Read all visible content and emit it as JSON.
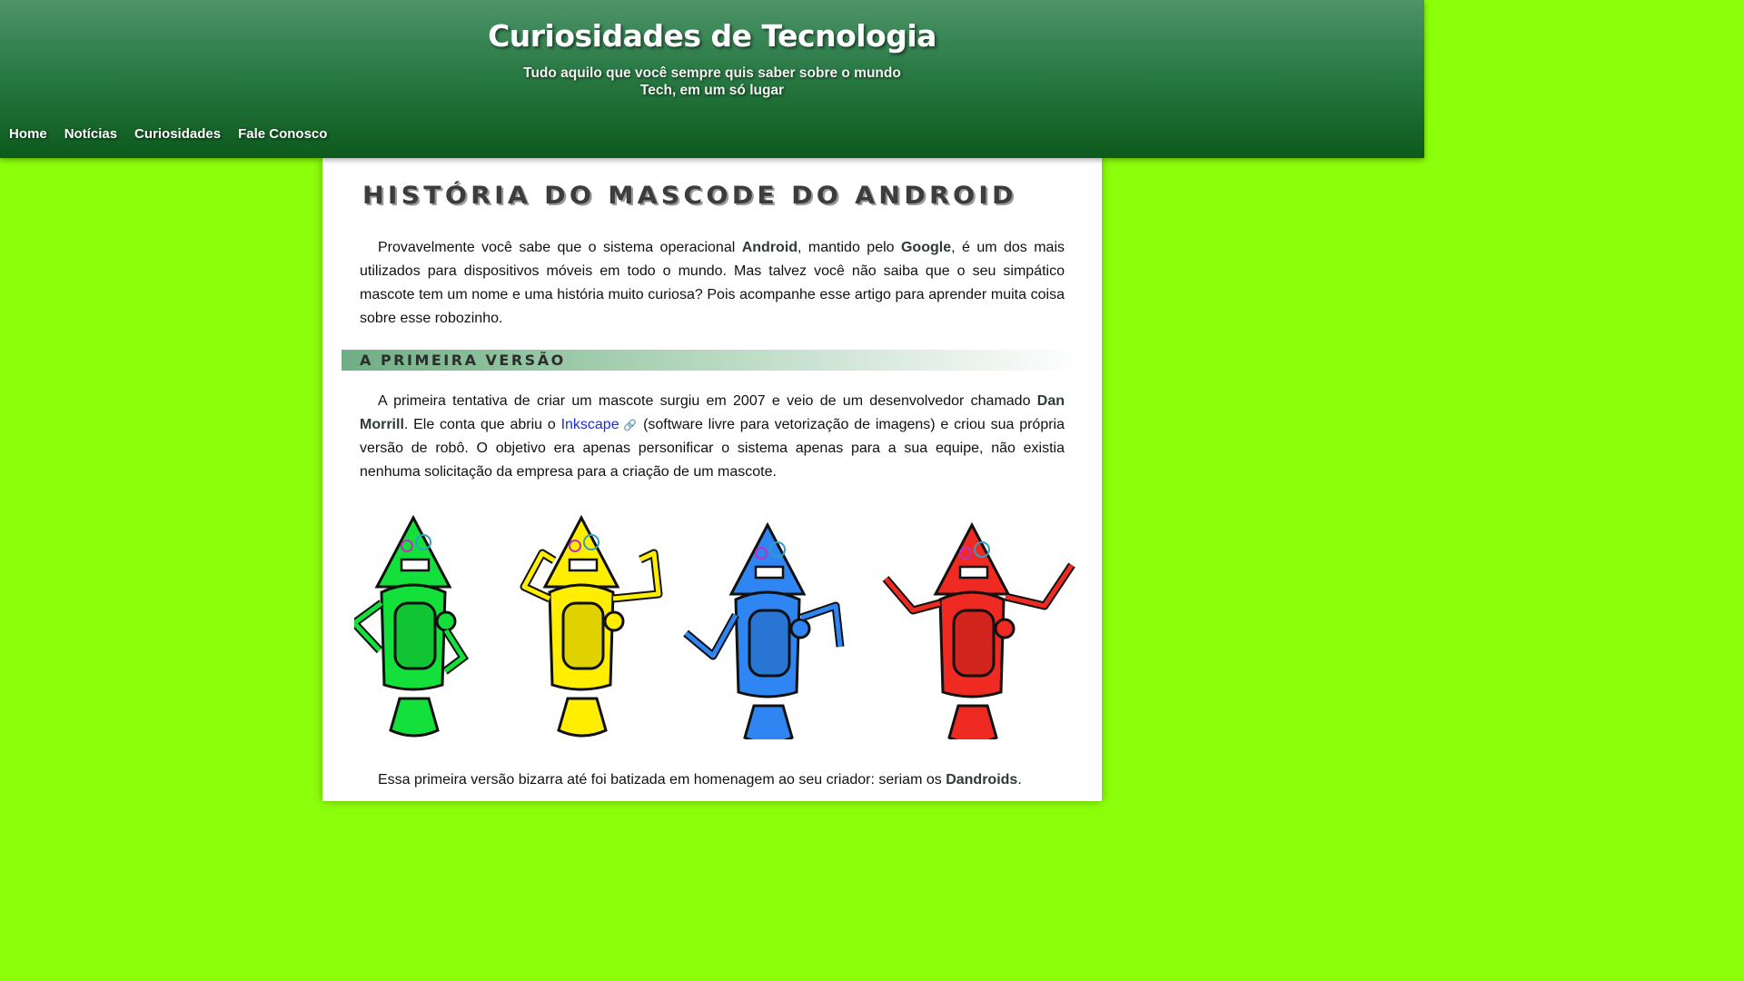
{
  "site": {
    "title": "Curiosidades de Tecnologia",
    "subtitle": "Tudo aquilo que você sempre quis saber sobre o mundo Tech, em um só lugar"
  },
  "nav": {
    "items": [
      "Home",
      "Notícias",
      "Curiosidades",
      "Fale Conosco"
    ]
  },
  "article": {
    "title": "HISTÓRIA DO MASCODE DO ANDROID",
    "intro": {
      "t1": "Provavelmente você sabe que o sistema operacional ",
      "b1": "Android",
      "t2": ", mantido pelo ",
      "b2": "Google",
      "t3": ", é um dos mais utilizados para dispositivos móveis em todo o mundo. Mas talvez você não saiba que o seu simpático mascote tem um nome e uma história muito curiosa? Pois acompanhe esse artigo para aprender muita coisa sobre esse robozinho."
    },
    "section1": {
      "heading": "A PRIMEIRA VERSÃO",
      "p1": {
        "t1": "A primeira tentativa de criar um mascote surgiu em 2007 e veio de um desenvolvedor chamado ",
        "b1": "Dan Morrill",
        "t2": ". Ele conta que abriu o ",
        "link": "Inkscape",
        "t3": " (software livre para vetorização de imagens) e criou sua própria versão de robô. O objetivo era apenas personificar o sistema apenas para a sua equipe, não existia nenhuma solicitação da empresa para a criação de um mascote."
      },
      "p2": {
        "t1": "Essa primeira versão bizarra até foi batizada em homenagem ao seu criador: seriam os ",
        "b1": "Dandroids",
        "t2": "."
      }
    }
  },
  "icons": {
    "external_link": "link-icon"
  },
  "colors": {
    "page_background": "#8cff0a",
    "header_top": "#4c9468",
    "header_bottom": "#0c5a1c",
    "link": "#1a2ee0",
    "mascot_green": "#14e03c",
    "mascot_yellow": "#ffee00",
    "mascot_blue": "#2f86f2",
    "mascot_red": "#ee2a22"
  }
}
